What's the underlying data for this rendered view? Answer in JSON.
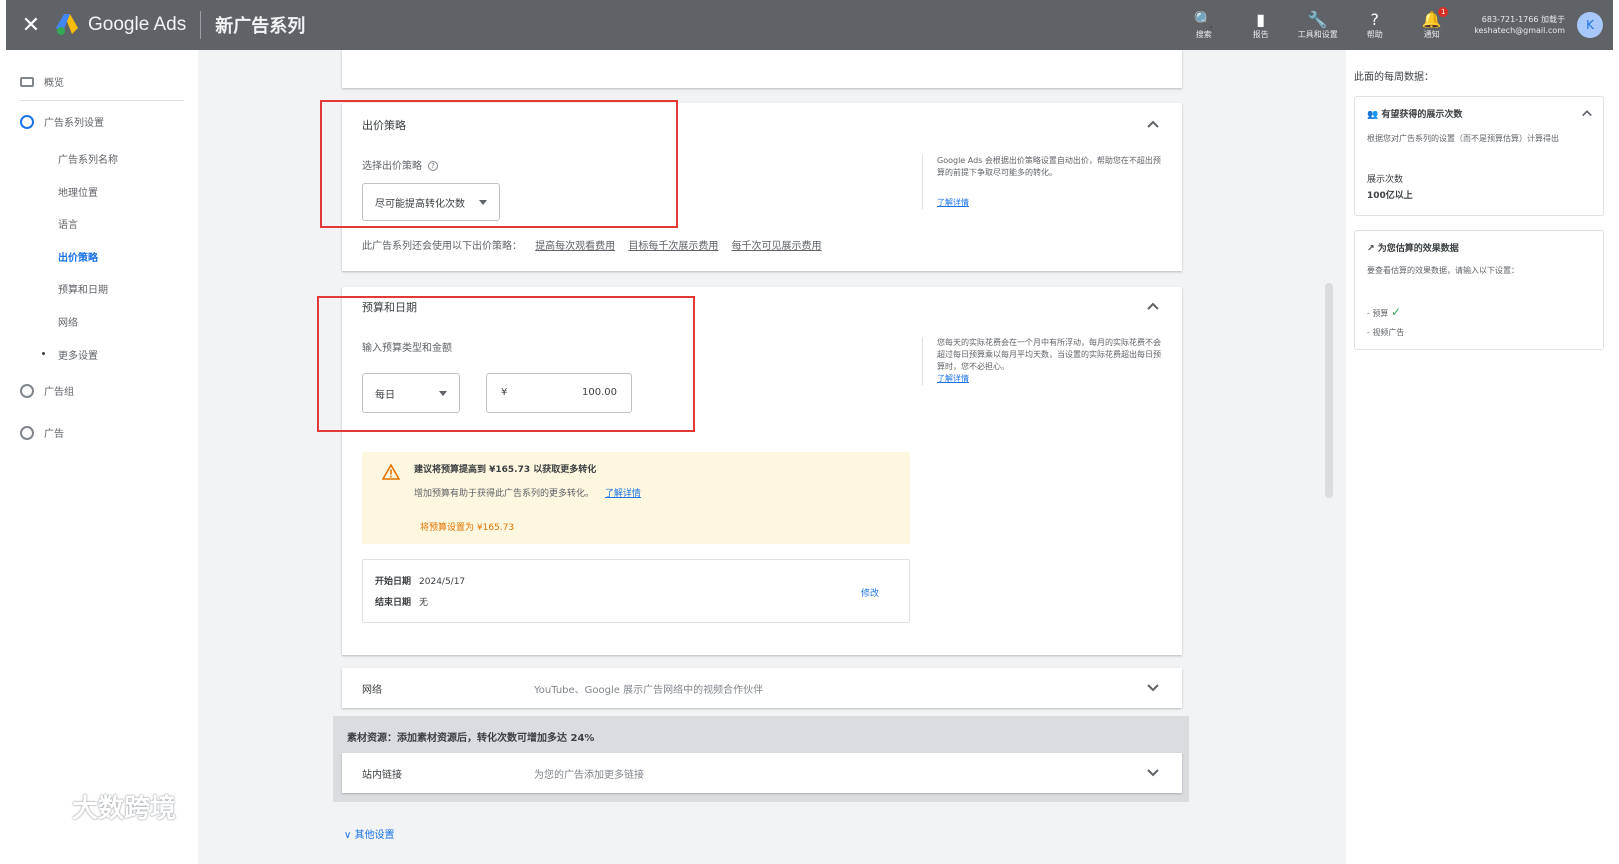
{
  "topbar": {
    "close_label": "✕",
    "brand": "Google Ads",
    "title": "新广告系列",
    "tools": [
      {
        "icon": "search-icon",
        "glyph": "🔍",
        "label": "搜索"
      },
      {
        "icon": "reports-icon",
        "glyph": "▮",
        "label": "报告"
      },
      {
        "icon": "wrench-icon",
        "glyph": "🔧",
        "label": "工具和设置"
      },
      {
        "icon": "help-icon",
        "glyph": "?",
        "label": "帮助"
      },
      {
        "icon": "bell-icon",
        "glyph": "🔔",
        "label": "通知",
        "badge": "1"
      }
    ],
    "account_line1": "683-721-1766 加载于",
    "account_line2": "keshatech@gmail.com",
    "avatar_letter": "K"
  },
  "leftnav": {
    "overview": "概览",
    "campaign_settings": "广告系列设置",
    "sub_items": [
      "广告系列名称",
      "地理位置",
      "语言",
      "出价策略",
      "预算和日期",
      "网络",
      "更多设置"
    ],
    "active_sub": "出价策略",
    "ad_groups": "广告组",
    "ads": "广告"
  },
  "watermark": "大数跨境",
  "bidding": {
    "title": "出价策略",
    "select_label": "选择出价策略",
    "help": "?",
    "selected_strategy": "尽可能提高转化次数",
    "alternatives_label": "此广告系列还会使用以下出价策略：",
    "alternatives": [
      "提高每次观看费用",
      "目标每千次展示费用",
      "每千次可见展示费用"
    ],
    "note": "Google Ads 会根据出价策略设置自动出价，帮助您在不超出预算的前提下争取尽可能多的转化。",
    "learn_more": "了解详情"
  },
  "budget": {
    "title": "预算和日期",
    "enter_label": "输入预算类型和金额",
    "type": "每日",
    "currency": "¥",
    "amount": "100.00",
    "note": "您每天的实际花费会在一个月中有所浮动，每月的实际花费不会超过每日预算乘以每月平均天数，当设置的实际花费超出每日预算时，您不必担心。",
    "learn_more": "了解详情",
    "warn_title": "建议将预算提高到 ¥165.73 以获取更多转化",
    "warn_body": "增加预算有助于获得此广告系列的更多转化。",
    "warn_link": "了解详情",
    "warn_action": "将预算设置为 ¥165.73",
    "start_label": "开始日期",
    "start_value": "2024/5/17",
    "end_label": "结束日期",
    "end_value": "无",
    "edit": "修改"
  },
  "network": {
    "label": "网络",
    "value": "YouTube、Google 展示广告网络中的视频合作伙伴"
  },
  "ai": {
    "title": "素材资源：添加素材资源后，转化次数可增加多达 24%",
    "row_label": "站内链接",
    "row_value": "为您的广告添加更多链接"
  },
  "more_settings": "其他设置",
  "rightpanel": {
    "title": "此面的每周数据：",
    "card1_title": "有望获得的展示次数",
    "card1_body": "根据您对广告系列的设置（而不是预算估算）计算得出",
    "card1_metric": "展示次数",
    "card1_value": "100亿以上",
    "card2_title": "为您估算的效果数据",
    "card2_body": "要查看估算的效果数据，请输入以下设置：",
    "card2_items": [
      "预算",
      "视频广告"
    ]
  },
  "colors": {
    "topbar": "#5f6368",
    "accent": "#1a73e8",
    "warning_bg": "#fef7e0",
    "annotation_red": "#e53935"
  }
}
